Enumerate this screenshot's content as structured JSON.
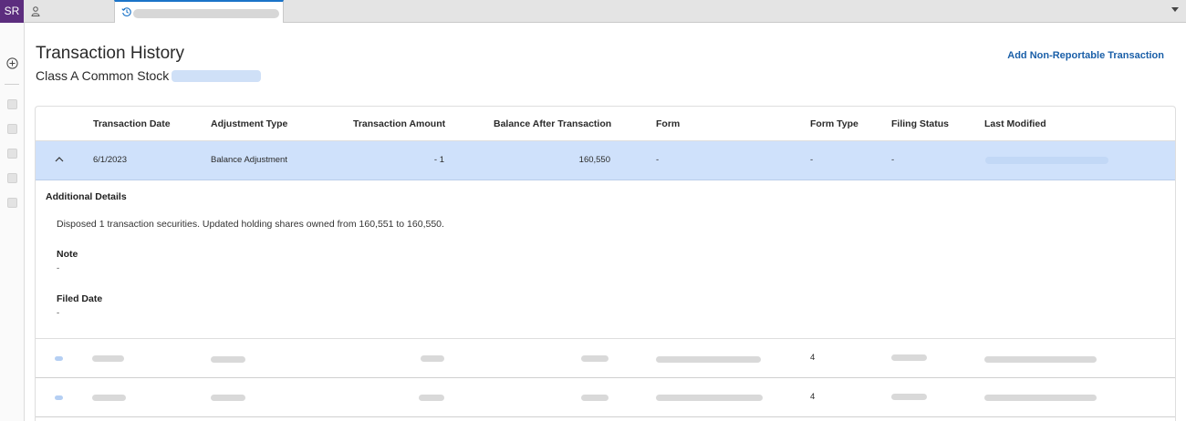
{
  "topbar": {
    "avatar_initials": "SR",
    "menu_icon": "chevron-down-icon"
  },
  "page": {
    "title": "Transaction History",
    "subtitle": "Class A Common Stock",
    "add_link": "Add Non-Reportable Transaction"
  },
  "table": {
    "columns": [
      "Transaction Date",
      "Adjustment Type",
      "Transaction Amount",
      "Balance After Transaction",
      "Form",
      "Form Type",
      "Filing Status",
      "Last Modified"
    ],
    "expanded_row": {
      "date": "6/1/2023",
      "adjustment_type": "Balance Adjustment",
      "amount": "- 1",
      "balance": "160,550",
      "form": "-",
      "form_type": "-",
      "filing_status": "-"
    },
    "details": {
      "heading": "Additional Details",
      "description": "Disposed 1 transaction securities. Updated holding shares owned from 160,551 to 160,550.",
      "note_label": "Note",
      "note_value": "-",
      "filed_label": "Filed Date",
      "filed_value": "-"
    },
    "rows": [
      {
        "form_type": "4"
      },
      {
        "form_type": "4"
      }
    ]
  },
  "colors": {
    "accent": "#1a73c8",
    "selected_row": "#cfe1fb",
    "link": "#1a5fa8",
    "avatar": "#5c2d7e"
  }
}
